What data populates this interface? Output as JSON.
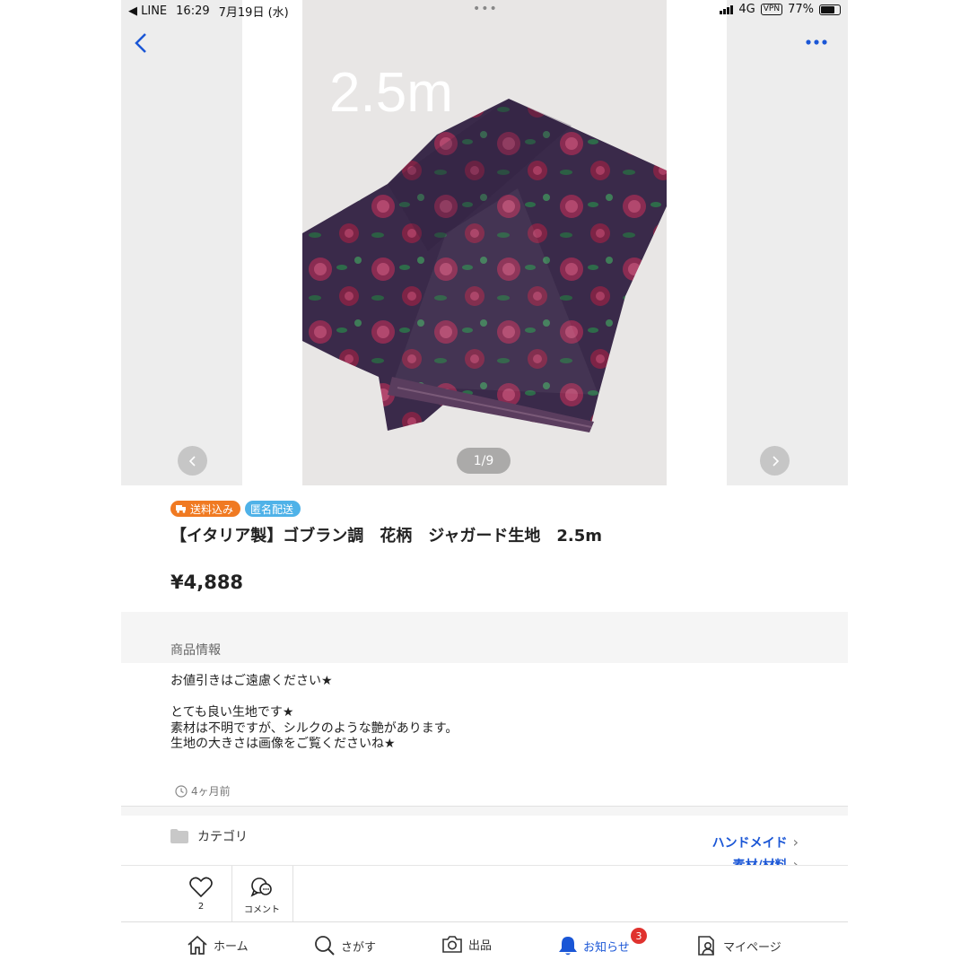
{
  "status_bar": {
    "carrier_back": "◀ LINE",
    "time": "16:29",
    "date": "7月19日 (水)",
    "network": "4G",
    "vpn": "VPN",
    "battery": "77%"
  },
  "gallery": {
    "overlay_text": "2.5m",
    "counter": "1/9",
    "prev_icon": "chevron-left-icon",
    "next_icon": "chevron-right-icon"
  },
  "badges": {
    "shipping": "送料込み",
    "anonymous": "匿名配送"
  },
  "item": {
    "title": "【イタリア製】ゴブラン調　花柄　ジャガード生地　2.5m",
    "price": "¥4,888"
  },
  "section": {
    "info_heading": "商品情報"
  },
  "description": {
    "lines": [
      "お値引きはご遠慮ください★",
      "",
      "とても良い生地です★",
      "素材は不明ですが、シルクのような艶があります。",
      "生地の大きさは画像をご覧くださいね★"
    ]
  },
  "posted": "4ヶ月前",
  "category": {
    "label": "カテゴリ",
    "links": [
      "ハンドメイド",
      "素材/材料"
    ]
  },
  "actions": {
    "like_count": "2",
    "comment_label": "コメント"
  },
  "tabbar": {
    "home": "ホーム",
    "search": "さがす",
    "sell": "出品",
    "notifications": "お知らせ",
    "notifications_badge": "3",
    "mypage": "マイページ"
  },
  "colors": {
    "accent": "#1a56d6",
    "shipping_badge": "#f07a22",
    "anonymous_badge": "#4fb2e8",
    "notification_badge": "#e0322e"
  }
}
